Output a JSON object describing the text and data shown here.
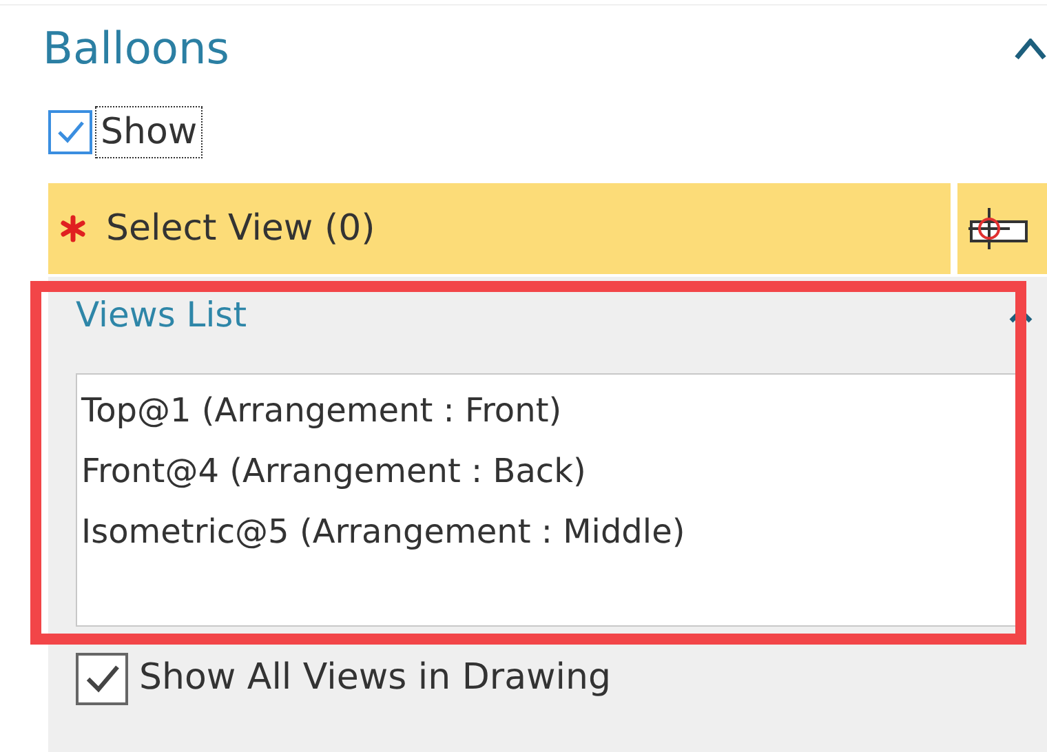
{
  "section": {
    "title": "Balloons",
    "expanded": true
  },
  "show_checkbox": {
    "label": "Show",
    "checked": true
  },
  "select_view": {
    "label": "Select View (0)",
    "required": true
  },
  "views_list": {
    "title": "Views List",
    "expanded": true,
    "highlighted": true,
    "items": [
      {
        "label": "Top@1 (Arrangement : Front)"
      },
      {
        "label": "Front@4 (Arrangement : Back)"
      },
      {
        "label": "Isometric@5 (Arrangement : Middle)"
      }
    ]
  },
  "show_all_checkbox": {
    "label": "Show All Views in Drawing",
    "checked": true
  }
}
